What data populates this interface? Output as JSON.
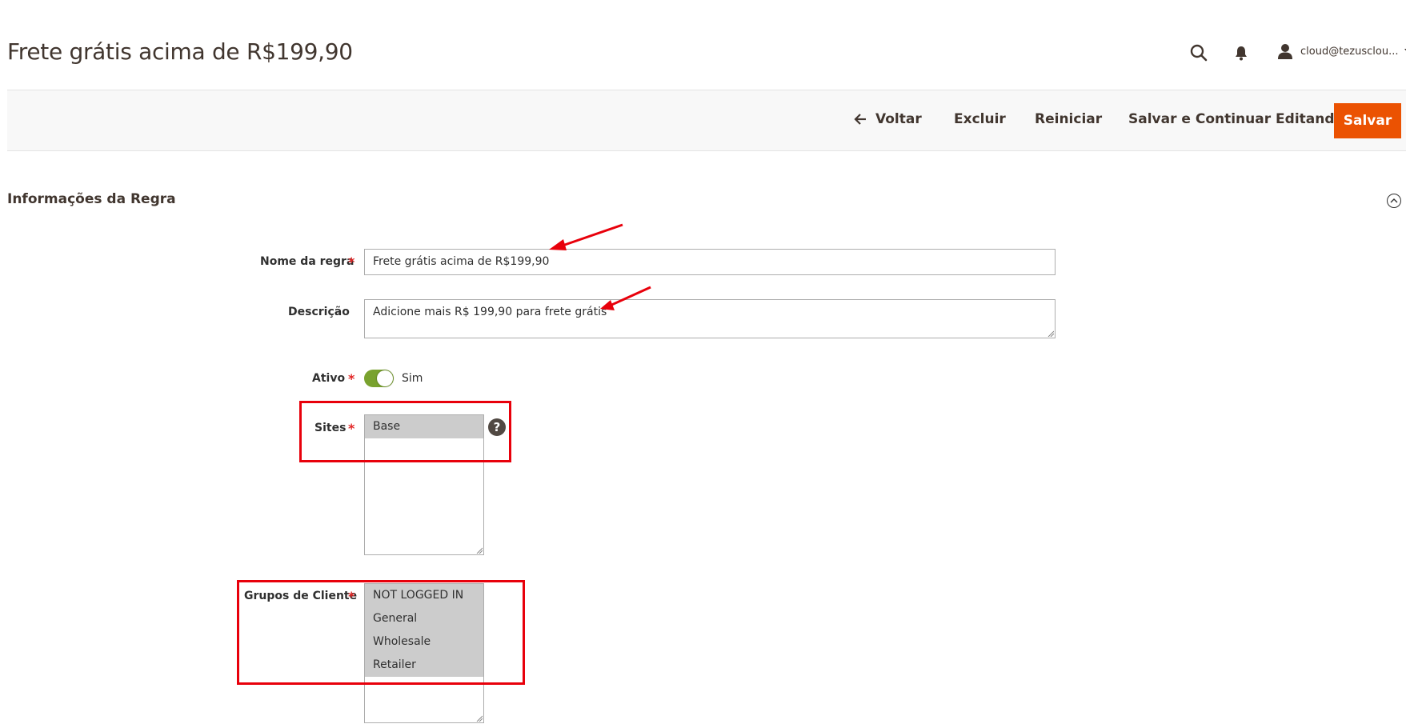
{
  "page": {
    "title": "Frete grátis acima de R$199,90"
  },
  "header": {
    "search_icon": "search-icon",
    "bell_icon": "bell-icon",
    "user_icon": "user-icon",
    "user_name": "cloud@tezusclou..."
  },
  "actions": {
    "back_label": "Voltar",
    "delete_label": "Excluir",
    "reset_label": "Reiniciar",
    "save_continue_label": "Salvar e Continuar Editando",
    "save_label": "Salvar"
  },
  "section": {
    "title": "Informações da Regra"
  },
  "form": {
    "rule_name": {
      "label": "Nome da regra",
      "required": "*",
      "value": "Frete grátis acima de R$199,90"
    },
    "description": {
      "label": "Descrição",
      "value": "Adicione mais R$ 199,90 para frete grátis"
    },
    "active": {
      "label": "Ativo",
      "required": "*",
      "value_label": "Sim",
      "checked": true
    },
    "sites": {
      "label": "Sites",
      "required": "*",
      "options": [
        "Base"
      ],
      "help": "?"
    },
    "customer_groups": {
      "label": "Grupos de Cliente",
      "required": "*",
      "options": [
        "NOT LOGGED IN",
        "General",
        "Wholesale",
        "Retailer"
      ]
    }
  },
  "colors": {
    "primary": "#eb5202",
    "toggle_on": "#79a22e",
    "annotation": "#e8000b",
    "selected_option": "#cccccc"
  }
}
